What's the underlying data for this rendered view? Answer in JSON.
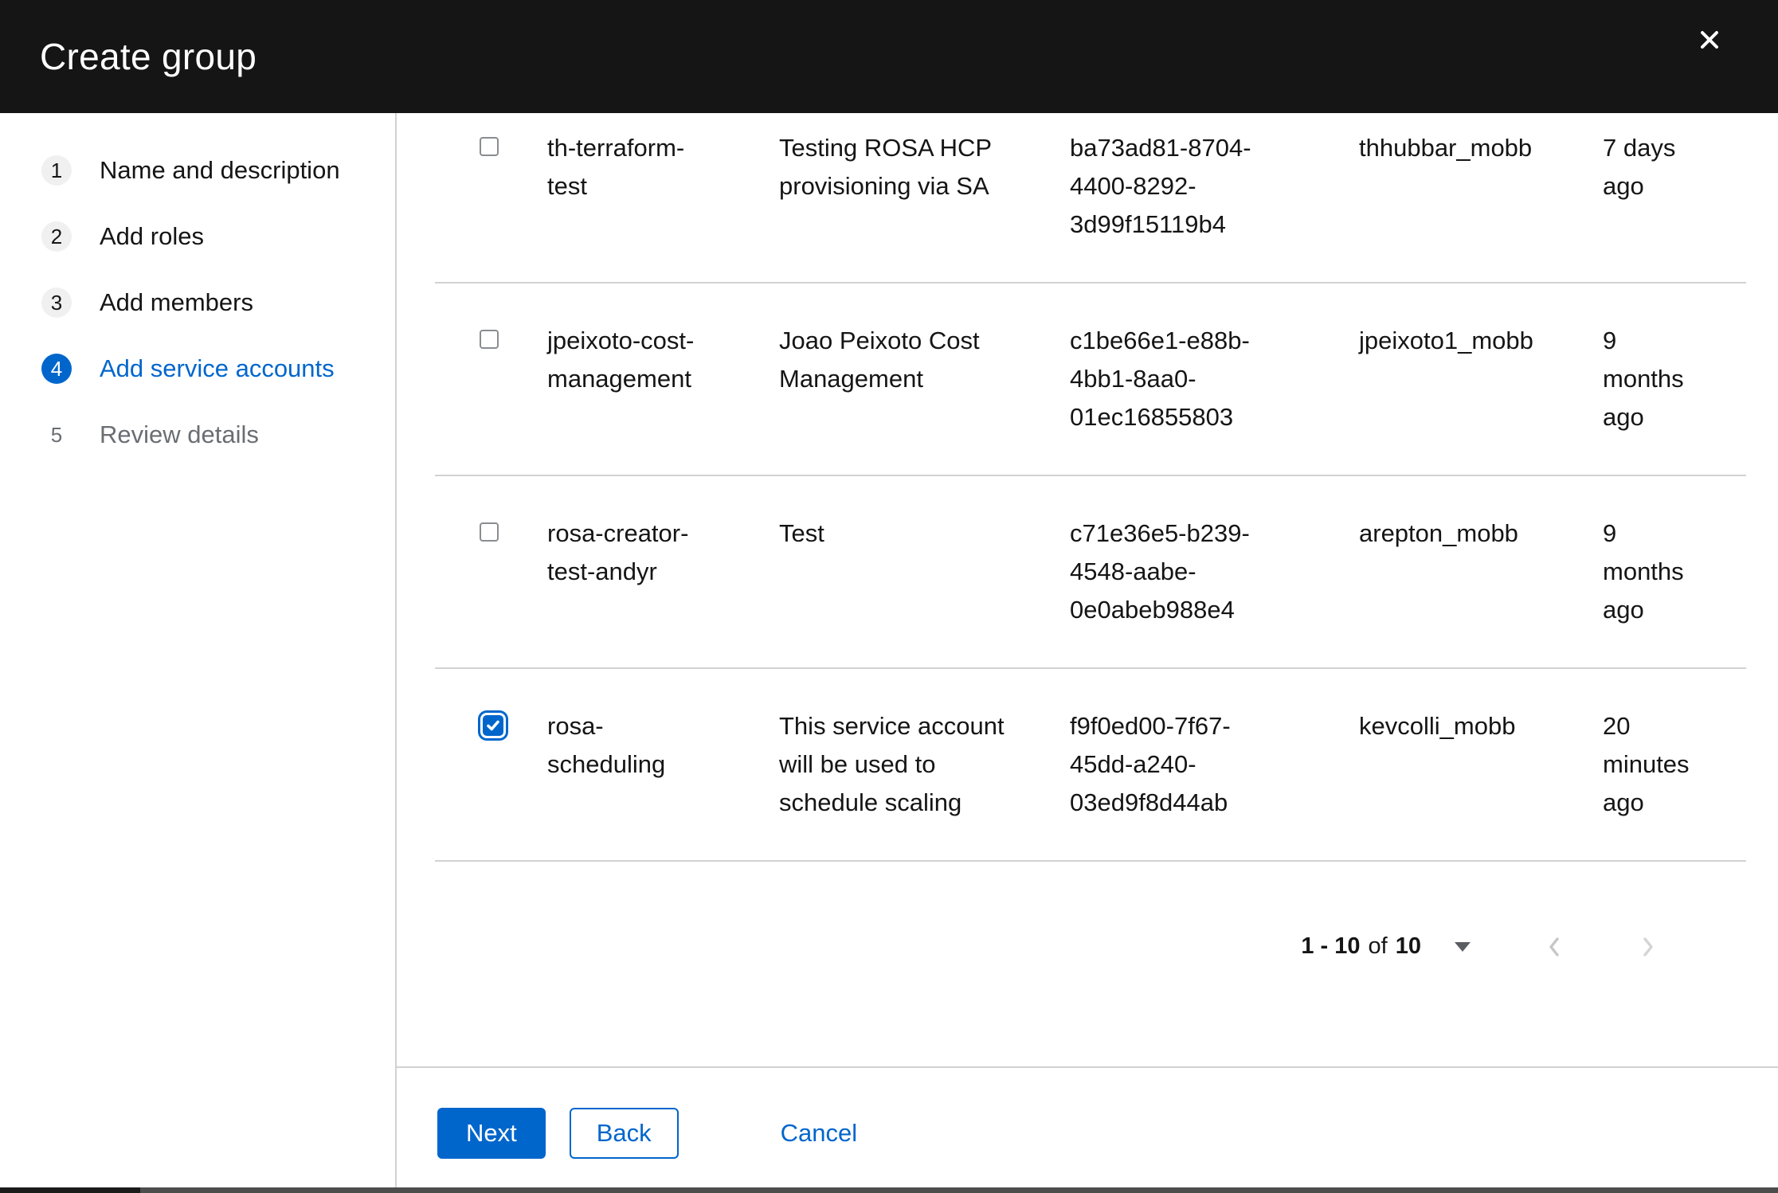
{
  "header": {
    "title": "Create group"
  },
  "wizard": {
    "steps": [
      {
        "number": "1",
        "label": "Name and description",
        "state": "default"
      },
      {
        "number": "2",
        "label": "Add roles",
        "state": "default"
      },
      {
        "number": "3",
        "label": "Add members",
        "state": "default"
      },
      {
        "number": "4",
        "label": "Add service accounts",
        "state": "active"
      },
      {
        "number": "5",
        "label": "Review details",
        "state": "upcoming"
      }
    ]
  },
  "table": {
    "rows": [
      {
        "checked": false,
        "name": "th-terraform-test",
        "description": "Testing ROSA HCP provisioning via SA",
        "client_id": "ba73ad81-8704-4400-8292-3d99f15119b4",
        "owner": "thhubbar_mobb",
        "time_created": "7 days ago"
      },
      {
        "checked": false,
        "name": "jpeixoto-cost-management",
        "description": "Joao Peixoto Cost Management",
        "client_id": "c1be66e1-e88b-4bb1-8aa0-01ec16855803",
        "owner": "jpeixoto1_mobb",
        "time_created": "9 months ago"
      },
      {
        "checked": false,
        "name": "rosa-creator-test-andyr",
        "description": "Test",
        "client_id": "c71e36e5-b239-4548-aabe-0e0abeb988e4",
        "owner": "arepton_mobb",
        "time_created": "9 months ago"
      },
      {
        "checked": true,
        "name": "rosa-scheduling",
        "description": "This service account will be used to schedule scaling",
        "client_id": "f9f0ed00-7f67-45dd-a240-03ed9f8d44ab",
        "owner": "kevcolli_mobb",
        "time_created": "20 minutes ago"
      }
    ]
  },
  "pagination": {
    "range": "1 - 10",
    "of_label": "of",
    "total": "10"
  },
  "footer": {
    "next_label": "Next",
    "back_label": "Back",
    "cancel_label": "Cancel"
  },
  "icons": {
    "close": "✕",
    "caret": "▾",
    "chevron_left": "‹",
    "chevron_right": "›",
    "check": "✓"
  },
  "colors": {
    "accent": "#0066cc",
    "header_bg": "#151515",
    "divider": "#d2d2d2",
    "text": "#151515",
    "muted_text": "#6a6e73",
    "disabled_chevron": "#d2d2d2"
  }
}
